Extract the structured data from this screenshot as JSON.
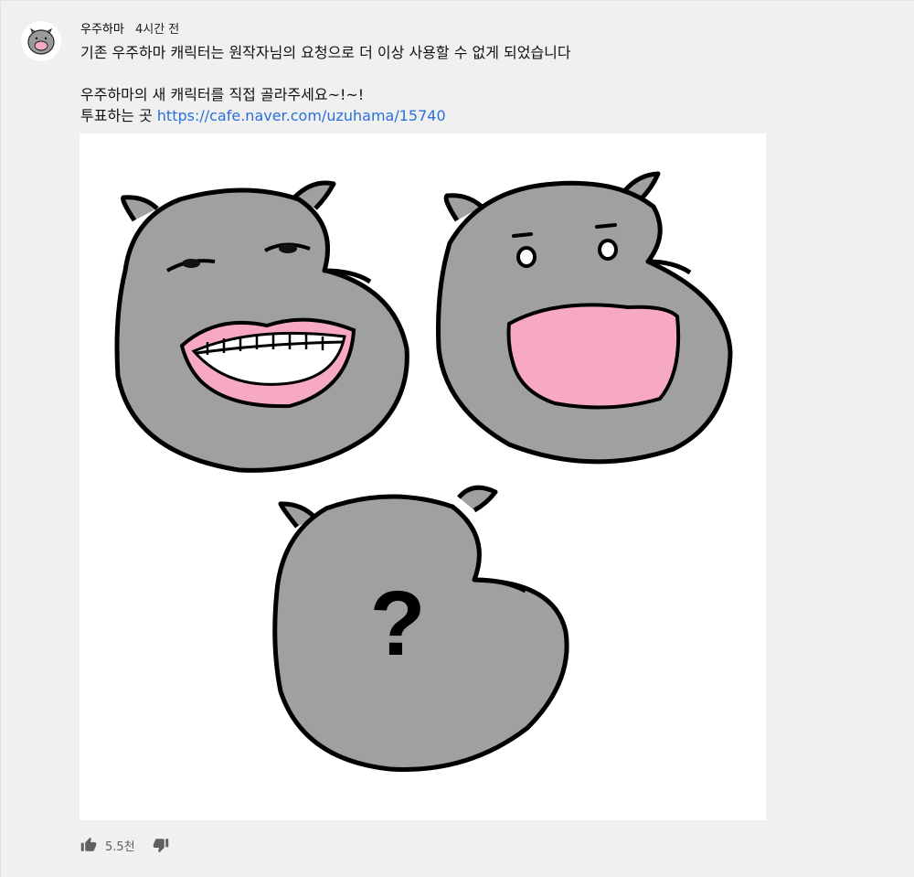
{
  "post": {
    "author": "우주하마",
    "time": "4시간 전",
    "lines": [
      "기존 우주하마 캐릭터는 원작자님의 요청으로 더 이상 사용할 수 없게 되었습니다",
      "",
      "우주하마의 새 캐릭터를 직접 골라주세요~!~!"
    ],
    "vote_prefix": "투표하는 곳",
    "vote_link": "https://cafe.naver.com/uzuhama/15740",
    "image_question_mark": "?"
  },
  "actions": {
    "like_count": "5.5천",
    "like_icon": "thumbs-up-icon",
    "dislike_icon": "thumbs-down-icon"
  },
  "colors": {
    "hippo_gray": "#a0a0a0",
    "mouth_pink": "#f7a8c4",
    "link_blue": "#2a6fdb",
    "background": "#f0f0f0"
  }
}
